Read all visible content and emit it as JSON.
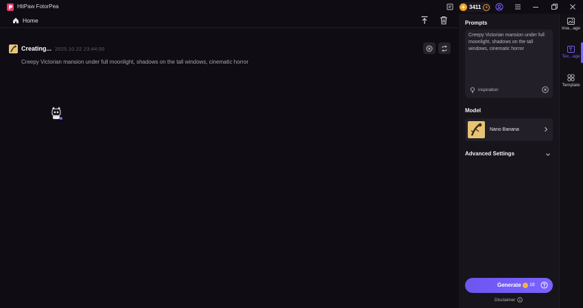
{
  "app": {
    "title": "HitPaw FotorPea",
    "credits": "3411",
    "credit_icon": "gift-icon",
    "colors": {
      "accent": "#7a62ff",
      "coin": "#f2a52e",
      "background": "#0f0d13",
      "panel": "#17151b"
    }
  },
  "header": {
    "home_label": "Home"
  },
  "task": {
    "status": "Creating...",
    "timestamp": "2025.10.22  23:44:50",
    "prompt": "Creepy Victorian mansion under full moonlight, shadows on the tall windows, cinematic horror"
  },
  "panel": {
    "prompts_label": "Prompts",
    "prompt_text": "Creepy Victorian mansion under full moonlight, shadows on the tall windows, cinematic horror",
    "inspiration_label": "inspiration",
    "model_label": "Model",
    "model_name": "Nano Banana",
    "advanced_label": "Advanced Settings",
    "generate_label": "Generate",
    "generate_cost": "16",
    "disclaimer": "Disclaimer"
  },
  "rail": {
    "items": [
      {
        "label": "Ima...age",
        "icon": "image-icon"
      },
      {
        "label": "Tex...age",
        "icon": "text-to-image-icon"
      },
      {
        "label": "Template",
        "icon": "template-icon"
      }
    ]
  }
}
